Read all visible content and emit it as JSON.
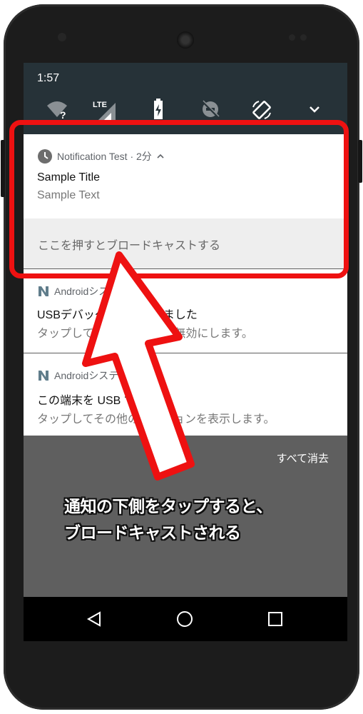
{
  "status_bar": {
    "time": "1:57"
  },
  "quick_settings": {
    "icons": [
      "wifi-unknown-icon",
      "lte-signal-icon",
      "battery-charging-icon",
      "do-not-disturb-off-icon",
      "auto-rotate-icon",
      "expand-chevron-icon"
    ],
    "lte_label": "LTE"
  },
  "notifications": [
    {
      "app": "Notification Test · 2分",
      "title": "Sample Title",
      "text": "Sample Text",
      "action": "ここを押すとブロードキャストする"
    },
    {
      "app": "Androidシステム",
      "title": "USBデバッグが接続されました",
      "text": "タップしてUSBデバッグを無効にします。"
    },
    {
      "app": "Androidシステム",
      "title": "この端末を USB で充電中",
      "text": "タップしてその他のオプションを表示します。"
    }
  ],
  "clear_all": "すべて消去",
  "annotation": {
    "line1": "通知の下側をタップすると、",
    "line2": "ブロードキャストされる"
  },
  "colors": {
    "highlight": "#ee1111",
    "status_bar": "#263238",
    "shade": "#5f5f5f"
  }
}
